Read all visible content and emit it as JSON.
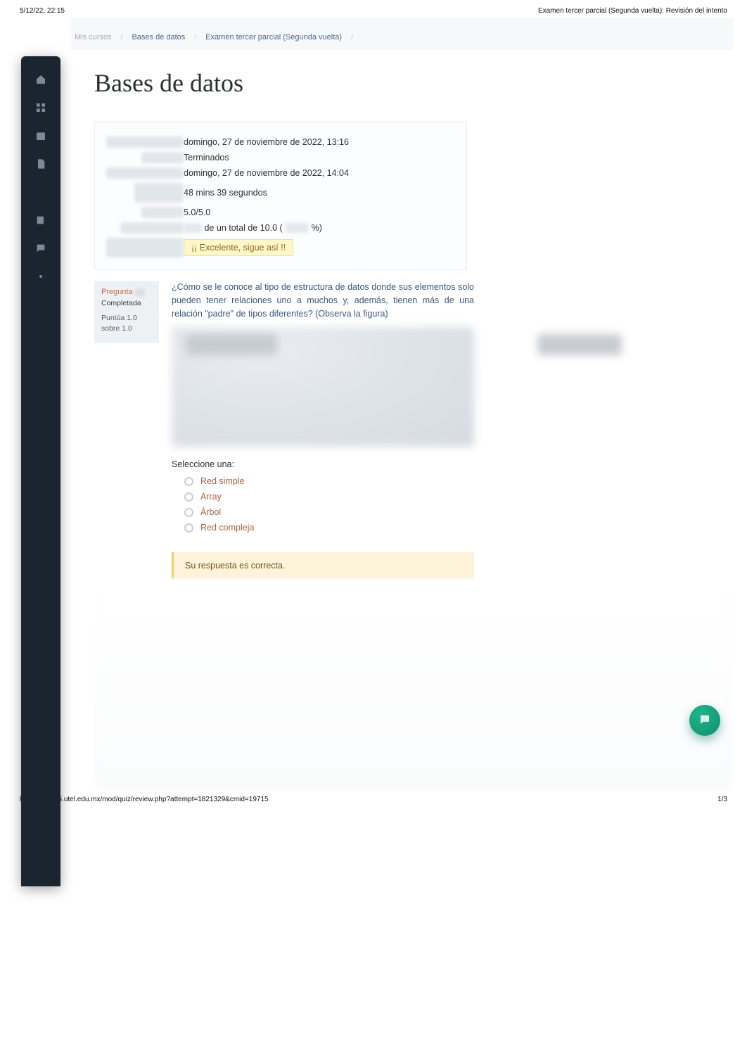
{
  "print": {
    "timestamp": "5/12/22, 22:15",
    "doc_title": "Examen tercer parcial (Segunda vuelta): Revisión del intento",
    "footer_url": "https://aula05.utel.edu.mx/mod/quiz/review.php?attempt=1821329&cmid=19715",
    "footer_page": "1/3"
  },
  "breadcrumb": {
    "root": "Mis cursos",
    "course": "Bases de datos",
    "page": "Examen tercer parcial (Segunda vuelta)"
  },
  "page_title": "Bases de datos",
  "review": {
    "started_on": "domingo, 27 de noviembre de 2022, 13:16",
    "state": "Terminados",
    "finished_on": "domingo, 27 de noviembre de 2022, 14:04",
    "time_taken": "48 mins 39 segundos",
    "points": "5.0/5.0",
    "grade_mid": "de un total de 10.0 (",
    "grade_suffix": "%)",
    "feedback": "¡¡ Excelente, sigue así !!"
  },
  "question": {
    "label": "Pregunta",
    "state": "Completada",
    "score_line1": "Puntúa 1.0",
    "score_line2": "sobre 1.0",
    "text": "¿Cómo se le conoce al tipo de estructura de datos donde sus elementos solo pueden tener relaciones uno a muchos y, además, tienen más de una relación \"padre\" de tipos diferentes? (Observa la figura)",
    "select_label": "Seleccione una:",
    "options": [
      "Red simple",
      "Array",
      "Árbol",
      "Red compleja"
    ],
    "feedback": "Su respuesta es correcta."
  }
}
